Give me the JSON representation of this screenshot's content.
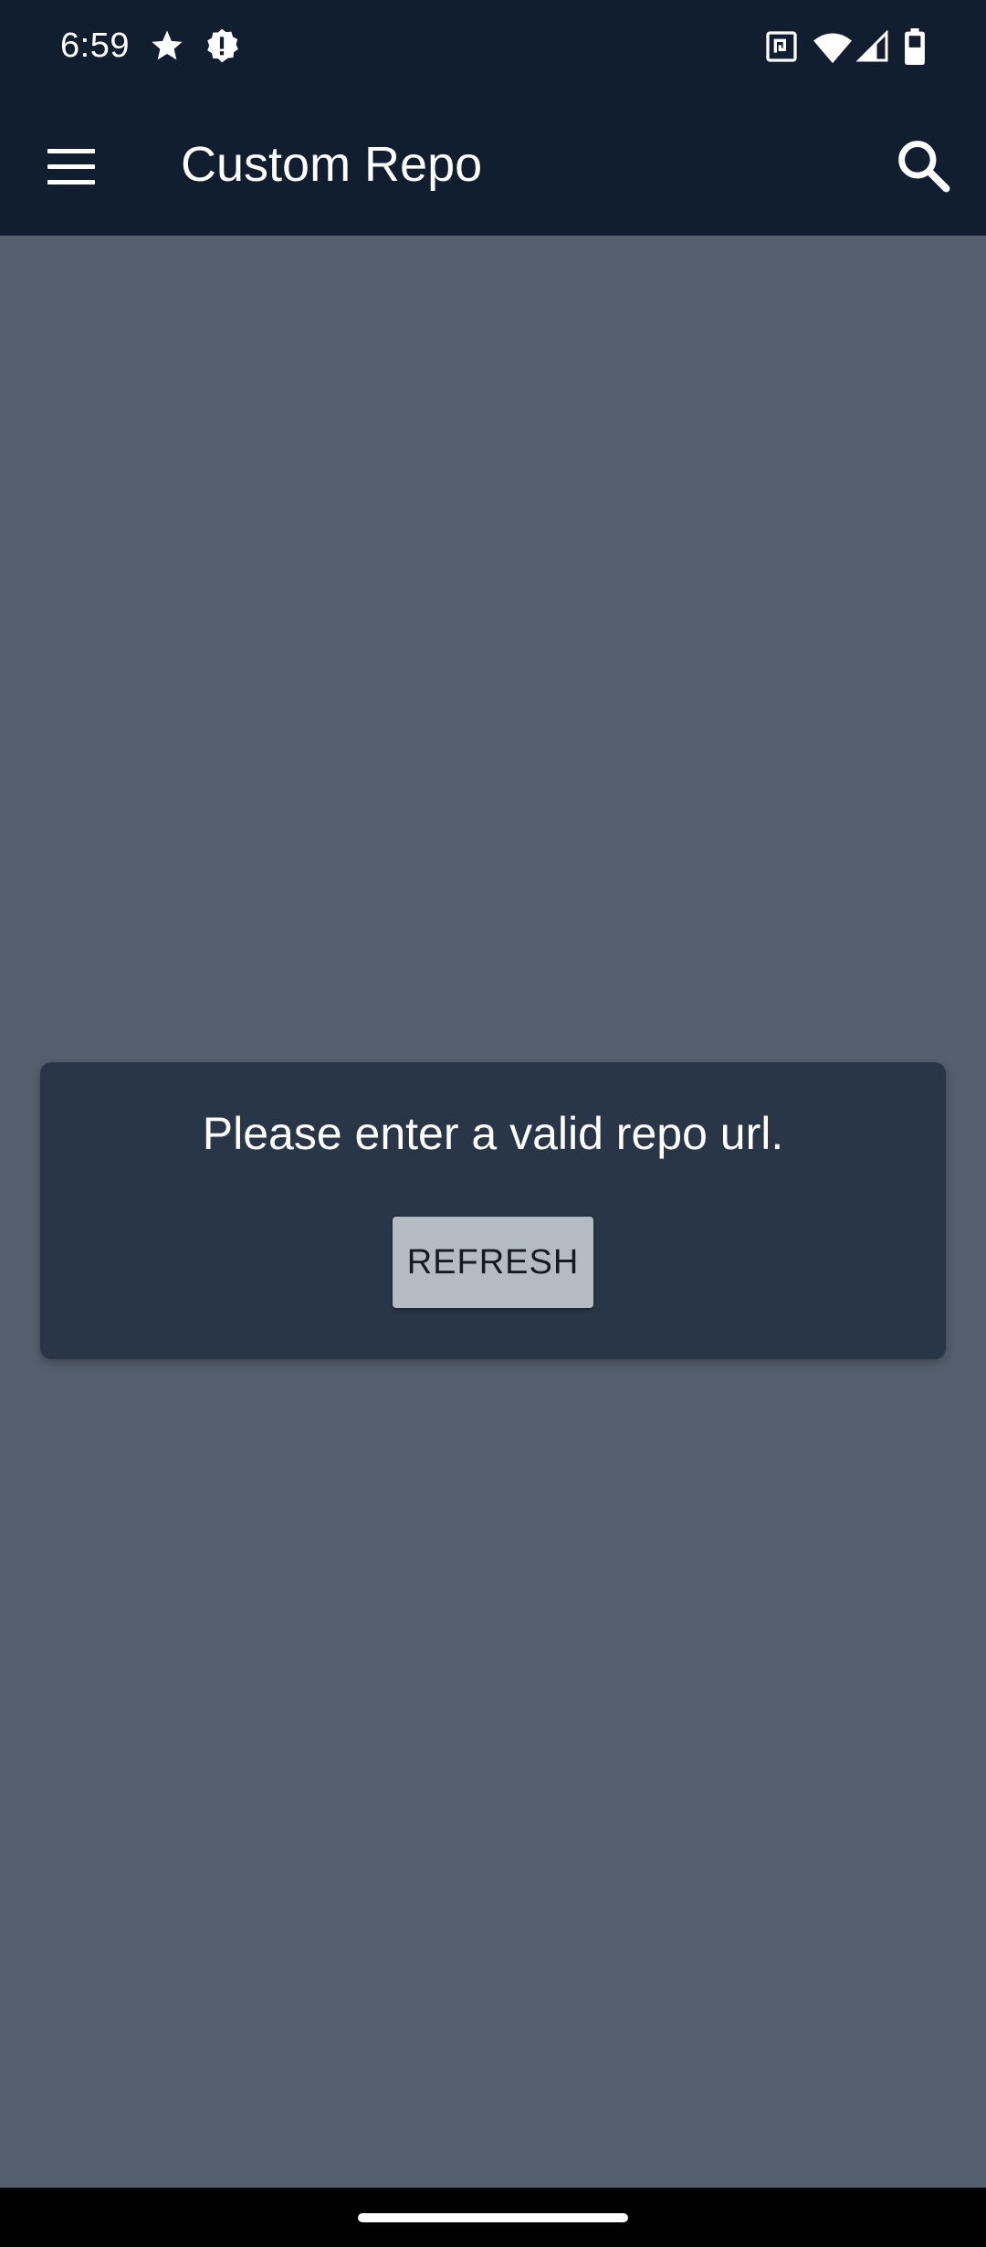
{
  "status_bar": {
    "time": "6:59",
    "notification_icons": [
      "star-icon",
      "alert-badge-icon"
    ],
    "system_icons": [
      "nfc-icon",
      "wifi-icon",
      "signal-icon",
      "battery-icon"
    ]
  },
  "app_bar": {
    "title": "Custom Repo",
    "menu_icon": "hamburger-menu-icon",
    "search_icon": "search-icon"
  },
  "content": {
    "message": "Please enter a valid repo url.",
    "refresh_label": "REFRESH"
  },
  "colors": {
    "app_bar_bg": "#111e30",
    "page_bg": "#545f6d",
    "card_bg": "#293647",
    "button_bg": "#b4bcc3"
  }
}
